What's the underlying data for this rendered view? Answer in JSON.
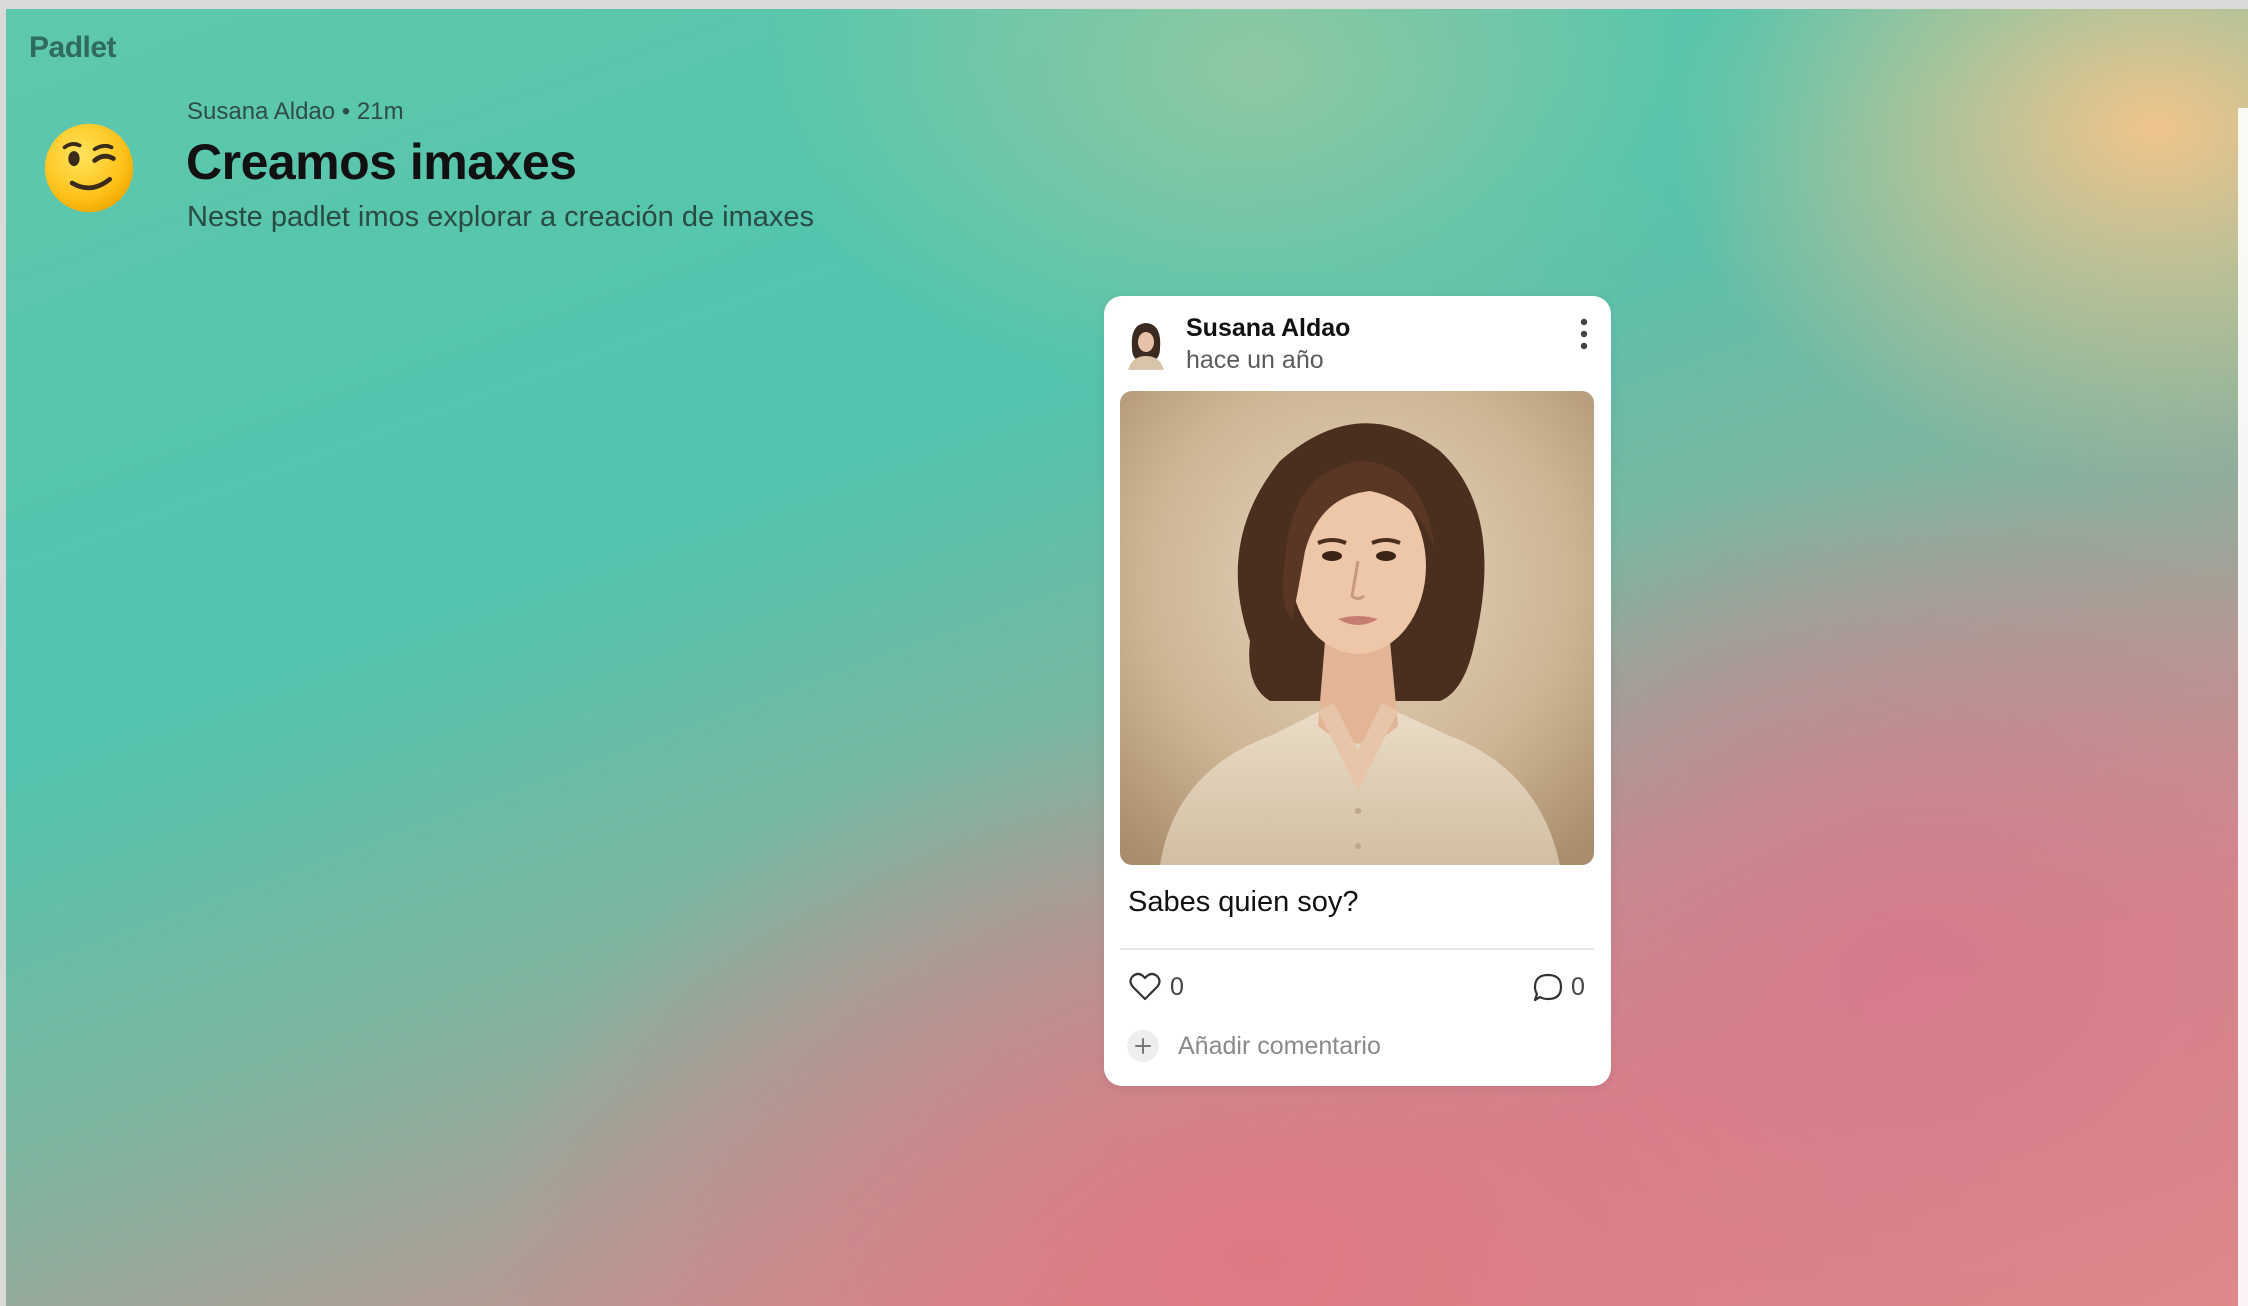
{
  "app": {
    "brand": "Padlet"
  },
  "header": {
    "emoji_icon": "winking-face",
    "author": "Susana Aldao",
    "separator": "•",
    "age": "21m",
    "title": "Creamos imaxes",
    "description": "Neste padlet imos explorar a creación de imaxes"
  },
  "post": {
    "author": "Susana Aldao",
    "time": "hace un año",
    "image_icon": "portrait-image",
    "caption": "Sabes quien soy?",
    "likes": "0",
    "comments": "0",
    "add_comment_placeholder": "Añadir comentario"
  },
  "colors": {
    "teal": "#50c4ae",
    "pink": "#df8a8a",
    "peach": "#f0c48c"
  }
}
